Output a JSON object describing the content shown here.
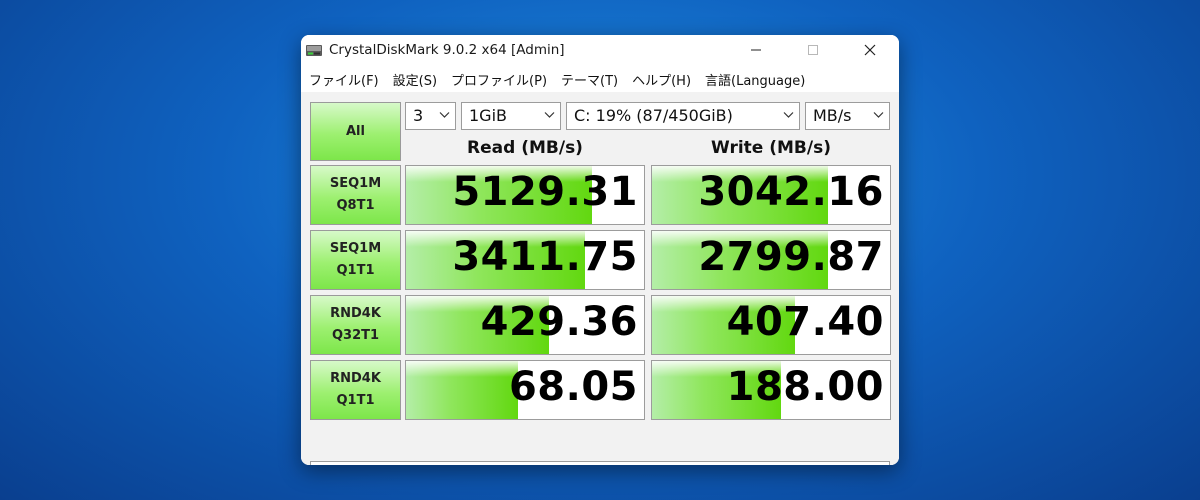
{
  "window": {
    "title": "CrystalDiskMark 9.0.2 x64 [Admin]"
  },
  "menu": [
    "ファイル(F)",
    "設定(S)",
    "プロファイル(P)",
    "テーマ(T)",
    "ヘルプ(H)",
    "言語(Language)"
  ],
  "controls": {
    "all_label": "All",
    "count": "3",
    "size": "1GiB",
    "drive": "C: 19% (87/450GiB)",
    "unit": "MB/s"
  },
  "headers": {
    "read": "Read (MB/s)",
    "write": "Write (MB/s)"
  },
  "tests": [
    {
      "line1": "SEQ1M",
      "line2": "Q8T1",
      "read": "5129.31",
      "write": "3042.16",
      "read_fill": 0.78,
      "write_fill": 0.74
    },
    {
      "line1": "SEQ1M",
      "line2": "Q1T1",
      "read": "3411.75",
      "write": "2799.87",
      "read_fill": 0.75,
      "write_fill": 0.74
    },
    {
      "line1": "RND4K",
      "line2": "Q32T1",
      "read": "429.36",
      "write": "407.40",
      "read_fill": 0.6,
      "write_fill": 0.6
    },
    {
      "line1": "RND4K",
      "line2": "Q1T1",
      "read": "68.05",
      "write": "188.00",
      "read_fill": 0.47,
      "write_fill": 0.54
    }
  ],
  "colors": {
    "accent_green": "#7de64a",
    "bar_green": "#62d810"
  }
}
